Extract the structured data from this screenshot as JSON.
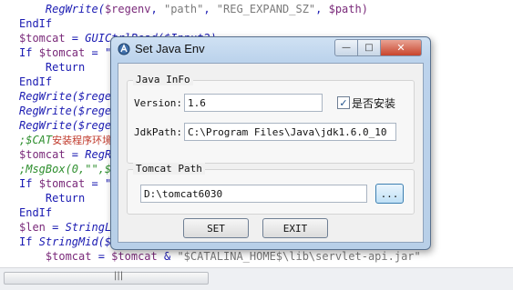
{
  "editor": {
    "lines": [
      {
        "indent": "    ",
        "parts": [
          {
            "t": "RegWrite(",
            "c": "#1a1ab2",
            "i": true
          },
          {
            "t": "$regenv",
            "c": "#7a2a7a",
            "i": false
          },
          {
            "t": ", ",
            "c": "#1a1ab2",
            "i": false
          },
          {
            "t": "\"path\"",
            "c": "#7a7a7a",
            "i": false
          },
          {
            "t": ", ",
            "c": "#1a1ab2",
            "i": false
          },
          {
            "t": "\"REG_EXPAND_SZ\"",
            "c": "#7a7a7a",
            "i": false
          },
          {
            "t": ", ",
            "c": "#1a1ab2",
            "i": false
          },
          {
            "t": "$path)",
            "c": "#7a2a7a",
            "i": false
          }
        ]
      },
      {
        "indent": "",
        "parts": [
          {
            "t": "EndIf",
            "c": "#1a1ab2",
            "i": false
          }
        ]
      },
      {
        "indent": "",
        "parts": [
          {
            "t": "$tomcat",
            "c": "#7a2a7a",
            "i": false
          },
          {
            "t": " = ",
            "c": "#1a1ab2",
            "i": false
          },
          {
            "t": "GUICtrlRead($Input2)",
            "c": "#1a1ab2",
            "i": true
          }
        ]
      },
      {
        "indent": "",
        "parts": [
          {
            "t": "If ",
            "c": "#1a1ab2",
            "i": false
          },
          {
            "t": "$tomcat",
            "c": "#7a2a7a",
            "i": false
          },
          {
            "t": " = \"",
            "c": "#1a1ab2",
            "i": false
          }
        ]
      },
      {
        "indent": "    ",
        "parts": [
          {
            "t": "Return",
            "c": "#1a1ab2",
            "i": false
          }
        ]
      },
      {
        "indent": "",
        "parts": [
          {
            "t": "EndIf",
            "c": "#1a1ab2",
            "i": false
          }
        ]
      },
      {
        "indent": "",
        "parts": [
          {
            "t": "RegWrite($rege",
            "c": "#1a1ab2",
            "i": true
          }
        ]
      },
      {
        "indent": "",
        "parts": [
          {
            "t": "RegWrite($rege",
            "c": "#1a1ab2",
            "i": true
          }
        ]
      },
      {
        "indent": "",
        "parts": [
          {
            "t": "RegWrite($rege",
            "c": "#1a1ab2",
            "i": true
          }
        ]
      },
      {
        "indent": "",
        "parts": [
          {
            "t": ";$CAT",
            "c": "#2f8f2f",
            "i": true
          },
          {
            "t": "安装程序环境变量里时使用",
            "c": "#c0392b",
            "i": false
          }
        ]
      },
      {
        "indent": "",
        "parts": [
          {
            "t": "$tomcat",
            "c": "#7a2a7a",
            "i": false
          },
          {
            "t": " = ",
            "c": "#1a1ab2",
            "i": false
          },
          {
            "t": "RegR",
            "c": "#1a1ab2",
            "i": true
          }
        ]
      },
      {
        "indent": "",
        "parts": [
          {
            "t": ";MsgBox(0,\"\",$",
            "c": "#2f8f2f",
            "i": true
          }
        ]
      },
      {
        "indent": "",
        "parts": [
          {
            "t": "If ",
            "c": "#1a1ab2",
            "i": false
          },
          {
            "t": "$tomcat",
            "c": "#7a2a7a",
            "i": false
          },
          {
            "t": " = \"",
            "c": "#1a1ab2",
            "i": false
          }
        ]
      },
      {
        "indent": "    ",
        "parts": [
          {
            "t": "Return",
            "c": "#1a1ab2",
            "i": false
          }
        ]
      },
      {
        "indent": "",
        "parts": [
          {
            "t": "EndIf",
            "c": "#1a1ab2",
            "i": false
          }
        ]
      },
      {
        "indent": "",
        "parts": [
          {
            "t": "$len",
            "c": "#7a2a7a",
            "i": false
          },
          {
            "t": " = ",
            "c": "#1a1ab2",
            "i": false
          },
          {
            "t": "StringL",
            "c": "#1a1ab2",
            "i": true
          }
        ]
      },
      {
        "indent": "",
        "parts": [
          {
            "t": "If ",
            "c": "#1a1ab2",
            "i": false
          },
          {
            "t": "StringMid($",
            "c": "#1a1ab2",
            "i": true
          }
        ]
      },
      {
        "indent": "    ",
        "parts": [
          {
            "t": "$tomcat",
            "c": "#7a2a7a",
            "i": false
          },
          {
            "t": " = ",
            "c": "#1a1ab2",
            "i": false
          },
          {
            "t": "$tomcat",
            "c": "#7a2a7a",
            "i": false
          },
          {
            "t": " & ",
            "c": "#1a1ab2",
            "i": false
          },
          {
            "t": "\"$CATALINA_HOME$\\lib\\servlet-api.jar\"",
            "c": "#7a7a7a",
            "i": false
          }
        ]
      }
    ]
  },
  "scrollbar": {
    "grip": "|||"
  },
  "dialog": {
    "title": "Set Java Env",
    "min_glyph": "—",
    "max_glyph": "□",
    "close_glyph": "✕",
    "java_group": {
      "label": "Java InFo",
      "version_label": "Version:",
      "version_value": "1.6",
      "installed_label": "是否安装",
      "installed_checked": true,
      "check_glyph": "✓",
      "jdkpath_label": "JdkPath:",
      "jdkpath_value": "C:\\Program Files\\Java\\jdk1.6.0_10"
    },
    "tomcat_group": {
      "label": "Tomcat Path",
      "path_value": "D:\\tomcat6030",
      "browse_label": "..."
    },
    "set_label": "SET",
    "exit_label": "EXIT"
  }
}
